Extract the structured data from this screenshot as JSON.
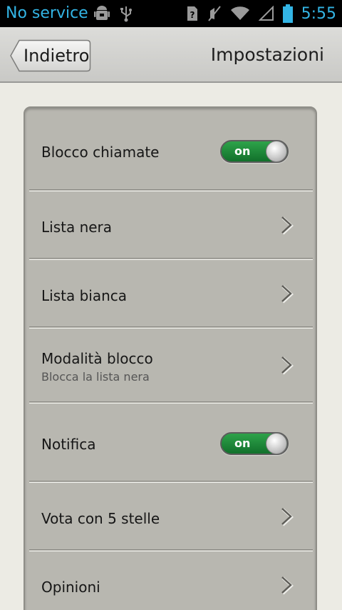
{
  "status_bar": {
    "carrier": "No service",
    "time": "5:55",
    "left_icons": [
      "android-debug-icon",
      "usb-icon"
    ],
    "right_icons": [
      "sim-unknown-icon",
      "mute-icon",
      "wifi-icon",
      "signal-icon",
      "battery-icon"
    ],
    "accent": "#33b5e5"
  },
  "header": {
    "back_label": "Indietro",
    "title": "Impostazioni"
  },
  "settings": {
    "call_block": {
      "label": "Blocco chiamate",
      "toggle": "on",
      "state": true
    },
    "blacklist": {
      "label": "Lista nera"
    },
    "whitelist": {
      "label": "Lista bianca"
    },
    "block_mode": {
      "label": "Modalità blocco",
      "sublabel": "Blocca la lista nera"
    },
    "notification": {
      "label": "Notifica",
      "toggle": "on",
      "state": true
    },
    "rate": {
      "label": "Vota con 5 stelle"
    },
    "feedback": {
      "label": "Opinioni"
    }
  },
  "colors": {
    "toggle_on": "#1f8a3a",
    "panel": "#b8b7b0",
    "background": "#ecebe4"
  }
}
